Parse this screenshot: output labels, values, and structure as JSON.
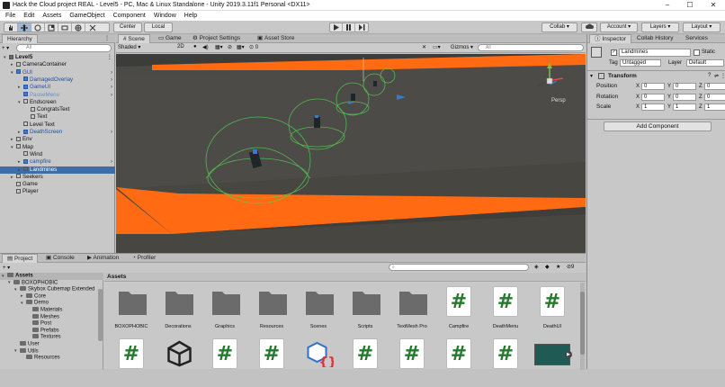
{
  "window": {
    "title": "Hack the Cloud project REAL - Level5 - PC, Mac & Linux Standalone - Unity 2019.3.11f1 Personal <DX11>",
    "minimize": "–",
    "maximize": "☐",
    "close": "✕"
  },
  "menu": [
    "File",
    "Edit",
    "Assets",
    "GameObject",
    "Component",
    "Window",
    "Help"
  ],
  "toolbar": {
    "pivot": "Center",
    "space": "Local",
    "collab": "Collab ▾",
    "account": "Account ▾",
    "layers": "Layers ▾",
    "layout": "Layout ▾"
  },
  "hierarchy": {
    "tab": "Hierarchy",
    "add": "+ ▾",
    "search_placeholder": "All",
    "items": [
      {
        "label": "Level5",
        "arrow": "▾",
        "kind": "scene"
      },
      {
        "label": "CameraContainer",
        "arrow": "▸",
        "kind": "obj"
      },
      {
        "label": "GUI",
        "arrow": "▾",
        "kind": "prefab"
      },
      {
        "label": "DamagedOverlay",
        "arrow": "",
        "kind": "prefab"
      },
      {
        "label": "GameUI",
        "arrow": "▸",
        "kind": "prefab"
      },
      {
        "label": "PauseMenu",
        "arrow": "",
        "kind": "prefab-faded"
      },
      {
        "label": "Endscreen",
        "arrow": "▾",
        "kind": "obj"
      },
      {
        "label": "CongratsText",
        "arrow": "",
        "kind": "obj"
      },
      {
        "label": "Text",
        "arrow": "",
        "kind": "obj"
      },
      {
        "label": "Level Text",
        "arrow": "",
        "kind": "obj"
      },
      {
        "label": "DeathScreen",
        "arrow": "▸",
        "kind": "prefab"
      },
      {
        "label": "Env",
        "arrow": "▸",
        "kind": "obj"
      },
      {
        "label": "Map",
        "arrow": "▾",
        "kind": "obj"
      },
      {
        "label": "Wind",
        "arrow": "",
        "kind": "obj"
      },
      {
        "label": "campfire",
        "arrow": "▸",
        "kind": "prefab"
      },
      {
        "label": "Landmines",
        "arrow": "▸",
        "kind": "selected"
      },
      {
        "label": "Seekers",
        "arrow": "▸",
        "kind": "obj"
      },
      {
        "label": "Game",
        "arrow": "",
        "kind": "obj"
      },
      {
        "label": "Player",
        "arrow": "",
        "kind": "obj"
      }
    ]
  },
  "scene": {
    "tabs": [
      "Scene",
      "Game",
      "Project Settings",
      "Asset Store"
    ],
    "shading": "Shaded",
    "mode_2d": "2D",
    "gizmo_count": "0",
    "gizmos": "Gizmos ▾",
    "search_placeholder": "All",
    "persp": "Persp"
  },
  "inspector": {
    "tabs": [
      "Inspector",
      "Collab History",
      "Services"
    ],
    "object_name": "Landmines",
    "static": "Static",
    "tag_label": "Tag",
    "tag": "Untagged",
    "layer_label": "Layer",
    "layer": "Default",
    "transform": "Transform",
    "rows": [
      {
        "label": "Position",
        "x": "0",
        "y": "0",
        "z": "0"
      },
      {
        "label": "Rotation",
        "x": "0",
        "y": "0",
        "z": "0"
      },
      {
        "label": "Scale",
        "x": "1",
        "y": "1",
        "z": "1"
      }
    ],
    "add_component": "Add Component"
  },
  "bottom": {
    "tabs": [
      "Project",
      "Console",
      "Animation",
      "Profiler"
    ],
    "add": "+ ▾",
    "search_placeholder": "",
    "hidden_count": "9",
    "path": "Assets",
    "tree": [
      {
        "label": "Assets",
        "depth": 0,
        "arrow": "▾",
        "bold": true
      },
      {
        "label": "BOXOPHOBIC",
        "depth": 1,
        "arrow": "▾"
      },
      {
        "label": "Skybox Cubemap Extended",
        "depth": 2,
        "arrow": "▾"
      },
      {
        "label": "Core",
        "depth": 3,
        "arrow": "▸"
      },
      {
        "label": "Demo",
        "depth": 3,
        "arrow": "▾"
      },
      {
        "label": "Materials",
        "depth": 4,
        "arrow": ""
      },
      {
        "label": "Meshes",
        "depth": 4,
        "arrow": ""
      },
      {
        "label": "Post",
        "depth": 4,
        "arrow": ""
      },
      {
        "label": "Prefabs",
        "depth": 4,
        "arrow": ""
      },
      {
        "label": "Textures",
        "depth": 4,
        "arrow": ""
      },
      {
        "label": "User",
        "depth": 2,
        "arrow": ""
      },
      {
        "label": "Utils",
        "depth": 2,
        "arrow": "▾"
      },
      {
        "label": "Resources",
        "depth": 3,
        "arrow": ""
      }
    ],
    "assets_row1": [
      {
        "label": "BOXOPHOBIC",
        "type": "folder"
      },
      {
        "label": "Decorations",
        "type": "folder"
      },
      {
        "label": "Graphics",
        "type": "folder"
      },
      {
        "label": "Resources",
        "type": "folder"
      },
      {
        "label": "Scenes",
        "type": "folder"
      },
      {
        "label": "Scripts",
        "type": "folder"
      },
      {
        "label": "TextMesh Pro",
        "type": "folder"
      },
      {
        "label": "Campfire",
        "type": "script"
      },
      {
        "label": "DeathMenu",
        "type": "script"
      },
      {
        "label": "DeathUI",
        "type": "script"
      }
    ],
    "assets_row2": [
      {
        "label": "",
        "type": "script"
      },
      {
        "label": "",
        "type": "unity"
      },
      {
        "label": "",
        "type": "script"
      },
      {
        "label": "",
        "type": "script"
      },
      {
        "label": "",
        "type": "cube"
      },
      {
        "label": "",
        "type": "script"
      },
      {
        "label": "",
        "type": "script"
      },
      {
        "label": "",
        "type": "script"
      },
      {
        "label": "",
        "type": "script"
      },
      {
        "label": "",
        "type": "media"
      }
    ]
  }
}
